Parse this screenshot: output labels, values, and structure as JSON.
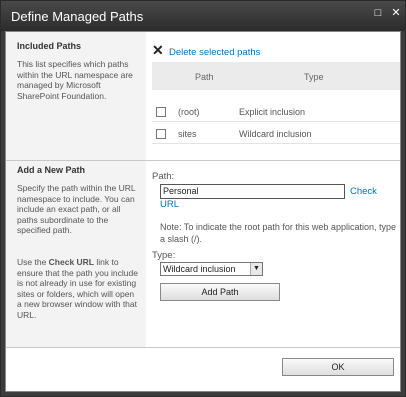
{
  "window": {
    "title": "Define Managed Paths",
    "maximize_glyph": "□",
    "close_glyph": "✕"
  },
  "included": {
    "title": "Included Paths",
    "description": "This list specifies which paths within the URL namespace are managed by Microsoft SharePoint Foundation.",
    "delete_label": "Delete selected paths",
    "columns": [
      "Path",
      "Type"
    ],
    "rows": [
      {
        "path": "(root)",
        "type": "Explicit inclusion"
      },
      {
        "path": "sites",
        "type": "Wildcard inclusion"
      }
    ]
  },
  "add": {
    "title": "Add a New Path",
    "desc1": "Specify the path within the URL namespace to include. You can include an exact path, or all paths subordinate to the specified path.",
    "desc2_pre": "Use the ",
    "desc2_bold": "Check URL",
    "desc2_post": " link to ensure that the path you include is not already in use for existing sites or folders, which will open a new browser window with that URL.",
    "path_label": "Path:",
    "path_value": "Personal",
    "check_url_1": "Check",
    "check_url_2": "URL",
    "note": "Note: To indicate the root path for this web application, type a slash (/).",
    "type_label": "Type:",
    "type_value": "Wildcard inclusion",
    "add_button": "Add Path"
  },
  "ok_button": "OK"
}
